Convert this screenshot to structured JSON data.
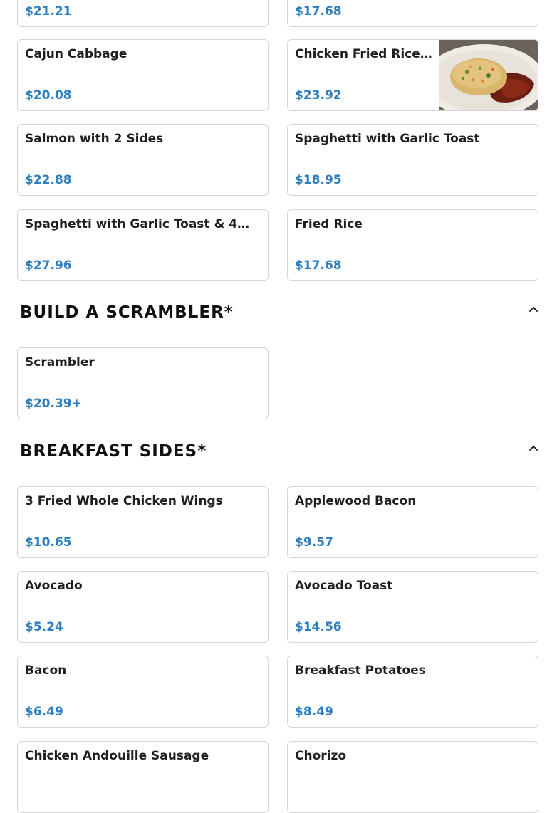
{
  "top_cards": [
    {
      "name": "",
      "price": "$21.21"
    },
    {
      "name": "",
      "price": "$17.68"
    }
  ],
  "cards_1": [
    {
      "name": "Cajun Cabbage",
      "price": "$20.08"
    },
    {
      "name": "Chicken Fried Rice…",
      "price": "$23.92"
    },
    {
      "name": "Salmon with 2 Sides",
      "price": "$22.88"
    },
    {
      "name": "Spaghetti with Garlic Toast",
      "price": "$18.95"
    },
    {
      "name": "Spaghetti with Garlic Toast & 4…",
      "price": "$27.96"
    },
    {
      "name": "Fried Rice",
      "price": "$17.68"
    }
  ],
  "section_scrambler": {
    "title": "BUILD A SCRAMBLER*",
    "icon": "chevron-up-icon",
    "items": [
      {
        "name": "Scrambler",
        "price": "$20.39+"
      }
    ]
  },
  "section_breakfast_sides": {
    "title": "BREAKFAST SIDES*",
    "icon": "chevron-up-icon",
    "items": [
      {
        "name": "3 Fried Whole Chicken Wings",
        "price": "$10.65"
      },
      {
        "name": "Applewood Bacon",
        "price": "$9.57"
      },
      {
        "name": "Avocado",
        "price": "$5.24"
      },
      {
        "name": "Avocado Toast",
        "price": "$14.56"
      },
      {
        "name": "Bacon",
        "price": "$6.49"
      },
      {
        "name": "Breakfast Potatoes",
        "price": "$8.49"
      },
      {
        "name": "Chicken Andouille Sausage",
        "price": ""
      },
      {
        "name": "Chorizo",
        "price": ""
      }
    ]
  },
  "colors": {
    "price": "#2b7ec1",
    "border": "#d6d6d6"
  }
}
